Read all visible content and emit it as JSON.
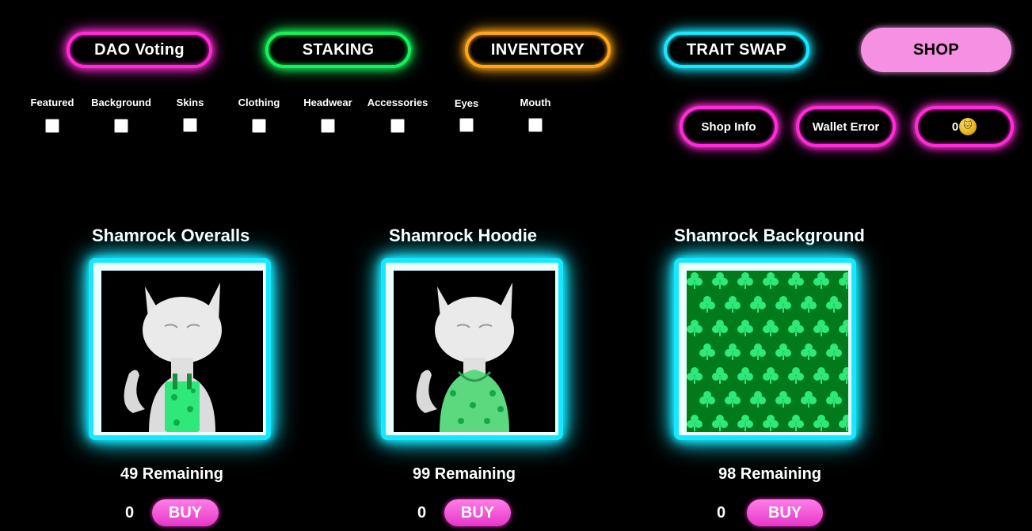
{
  "nav": {
    "dao": "DAO Voting",
    "staking": "STAKING",
    "inventory": "INVENTORY",
    "trait_swap": "TRAIT SWAP",
    "shop": "SHOP"
  },
  "filters": [
    "Featured",
    "Background",
    "Skins",
    "Clothing",
    "Headwear",
    "Accessories",
    "Eyes",
    "Mouth"
  ],
  "actions": {
    "shop_info": "Shop Info",
    "wallet_error": "Wallet Error",
    "balance": "0",
    "coin_icon": "coin-icon"
  },
  "items": [
    {
      "title": "Shamrock Overalls",
      "remaining": "49 Remaining",
      "qty": "0",
      "buy": "BUY"
    },
    {
      "title": "Shamrock Hoodie",
      "remaining": "99 Remaining",
      "qty": "0",
      "buy": "BUY"
    },
    {
      "title": "Shamrock Background",
      "remaining": "98 Remaining",
      "qty": "0",
      "buy": "BUY"
    }
  ],
  "colors": {
    "dao": "#ff2bd6",
    "staking": "#14f25a",
    "inventory": "#ffa51a",
    "trait": "#18e8ff",
    "shop": "#f690e2",
    "shamrock_green": "#2ee87a",
    "bg_green": "#007a1a"
  }
}
